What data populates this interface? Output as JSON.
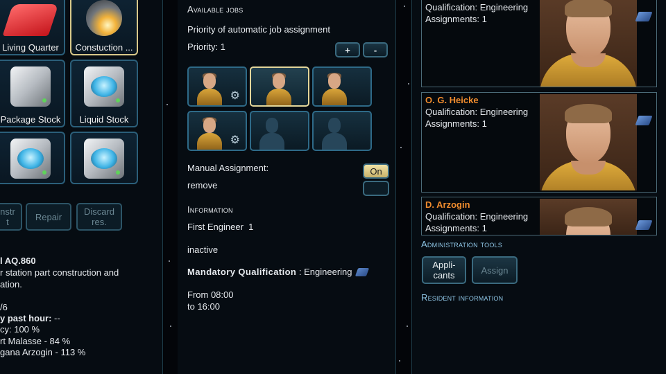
{
  "left": {
    "tiles": [
      {
        "label": "Living Quarter",
        "icon": "bed-icon"
      },
      {
        "label": "Constuction ...",
        "icon": "construction-drill-icon"
      },
      {
        "label": "Package Stock",
        "icon": "package-stock-icon"
      },
      {
        "label": "Liquid Stock",
        "icon": "liquid-stock-icon"
      },
      {
        "label": "",
        "icon": "liquid-stock-icon"
      },
      {
        "label": "",
        "icon": "liquid-stock-icon"
      }
    ],
    "buttons": {
      "construct": "nstr\nt",
      "repair": "Repair",
      "discard": "Discard\nres."
    },
    "details": {
      "title": "l AQ.860",
      "desc1": "r station part construction and",
      "desc2": "ation.",
      "count": "/6",
      "past_hour_label": "y past hour:",
      "past_hour_value": " --",
      "efficiency": "cy: 100 %",
      "worker1": "rt Malasse - 84 %",
      "worker2": "gana Arzogin - 113 %"
    }
  },
  "middle": {
    "available_jobs_heading": "Available jobs",
    "priority_desc": "Priority of automatic job assignment",
    "priority_label": "Priority: 1",
    "plus_label": "+",
    "minus_label": "-",
    "manual_label": "Manual Assignment:",
    "manual_toggle": "On",
    "remove_label": "remove",
    "information_heading": "Information",
    "job_title": "First Engineer",
    "job_count": "1",
    "status": "inactive",
    "mandatory_label": "Mandatory Qualification",
    "mandatory_value": "Engineering",
    "from": "From 08:00",
    "to": "to 16:00"
  },
  "right": {
    "residents": [
      {
        "name": "",
        "qualification": "Qualification: Engineering",
        "assignments": "Assignments: 1"
      },
      {
        "name": "O. G. Heicke",
        "qualification": "Qualification: Engineering",
        "assignments": "Assignments: 1"
      },
      {
        "name": "D. Arzogin",
        "qualification": "Qualification: Engineering",
        "assignments": "Assignments: 1"
      }
    ],
    "admin_heading": "Administration tools",
    "applicants_button": "Appli-\ncants",
    "assign_button": "Assign",
    "resident_info_heading": "Resident information"
  },
  "colors": {
    "accent_heading": "#8fc6e6",
    "resident_name": "#f08c2e",
    "selected_border": "#e3d69a",
    "toggle_on": "#e6d597"
  }
}
